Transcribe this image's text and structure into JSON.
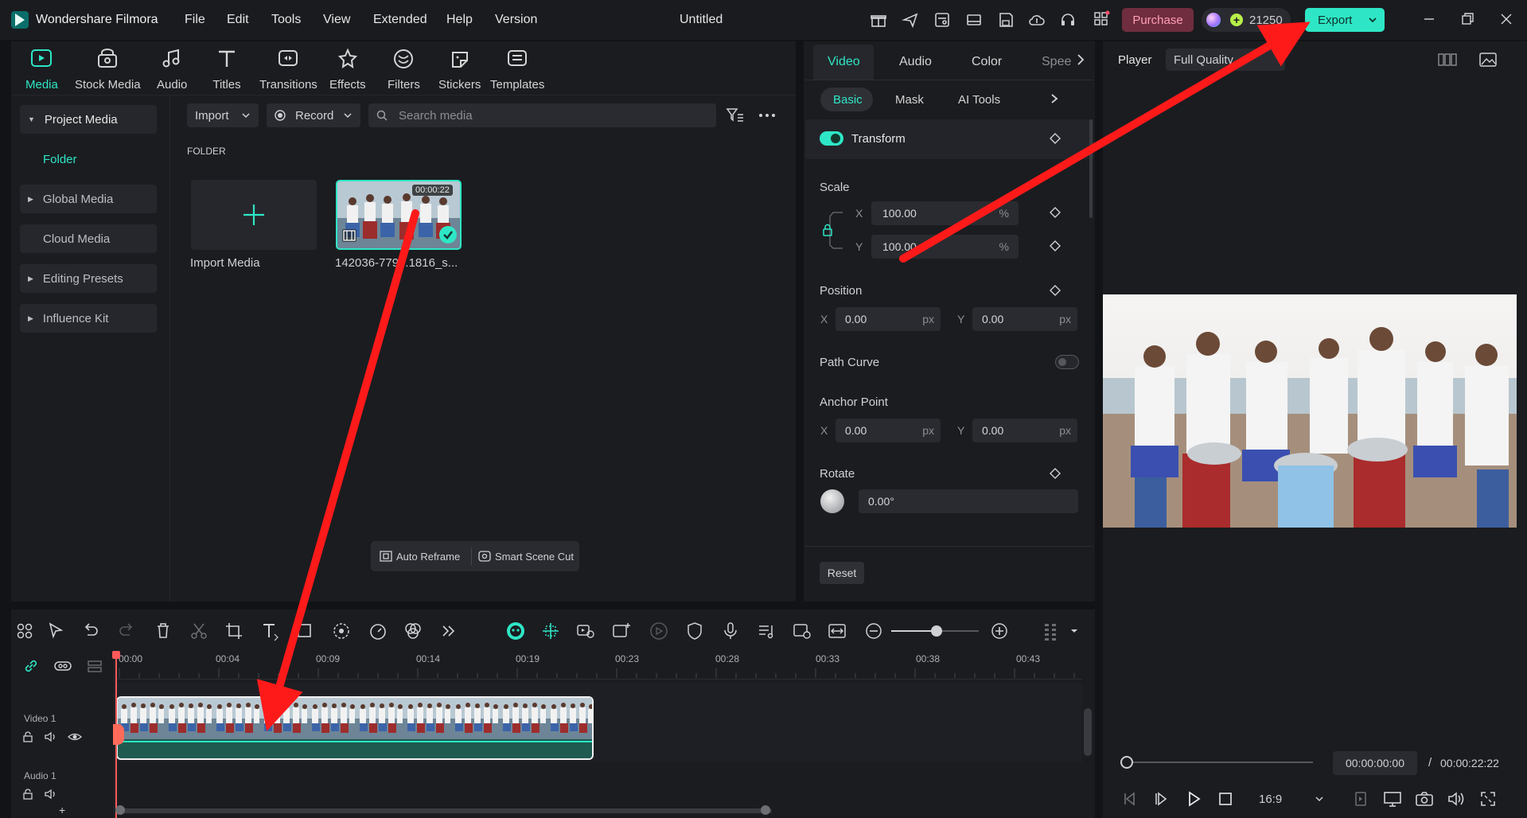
{
  "app": {
    "name": "Wondershare Filmora",
    "project_title": "Untitled",
    "menu": [
      "File",
      "Edit",
      "Tools",
      "View",
      "Extended",
      "Help",
      "Version"
    ],
    "purchase_label": "Purchase",
    "credits": "21250",
    "export_label": "Export"
  },
  "media_tabs": [
    "Media",
    "Stock Media",
    "Audio",
    "Titles",
    "Transitions",
    "Effects",
    "Filters",
    "Stickers",
    "Templates"
  ],
  "sidebar": {
    "project_media": "Project Media",
    "folder": "Folder",
    "items": [
      "Global Media",
      "Cloud Media",
      "Editing Presets",
      "Influence Kit"
    ]
  },
  "media_toolbar": {
    "import_label": "Import",
    "record_label": "Record",
    "search_placeholder": "Search media"
  },
  "library": {
    "section_label": "FOLDER",
    "import_tile_label": "Import Media",
    "clip": {
      "duration": "00:00:22",
      "name": "142036-779...1816_s..."
    }
  },
  "library_actions": {
    "auto_reframe": "Auto Reframe",
    "smart_scene_cut": "Smart Scene Cut"
  },
  "properties": {
    "tabs": [
      "Video",
      "Audio",
      "Color",
      "Spee"
    ],
    "subtabs": [
      "Basic",
      "Mask",
      "AI Tools"
    ],
    "transform_label": "Transform",
    "transform_enabled": true,
    "scale_label": "Scale",
    "scale_x": "100.00",
    "scale_y": "100.00",
    "percent": "%",
    "position_label": "Position",
    "position_x": "0.00",
    "position_y": "0.00",
    "px": "px",
    "path_curve_label": "Path Curve",
    "anchor_label": "Anchor Point",
    "anchor_x": "0.00",
    "anchor_y": "0.00",
    "rotate_label": "Rotate",
    "rotate_value": "0.00°",
    "reset_label": "Reset",
    "x": "X",
    "y": "Y"
  },
  "player": {
    "label": "Player",
    "quality": "Full Quality",
    "current_time": "00:00:00:00",
    "separator": "/",
    "total_time": "00:00:22:22",
    "aspect": "16:9"
  },
  "timeline": {
    "ruler": [
      "00:00",
      "00:04",
      "00:09",
      "00:14",
      "00:19",
      "00:23",
      "00:28",
      "00:33",
      "00:38",
      "00:43"
    ],
    "video_track": "Video 1",
    "audio_track": "Audio 1"
  },
  "colors": {
    "accent": "#2ee6c5",
    "export_bg": "#2ee6c5",
    "purchase_bg": "#6f2d3f",
    "arrow": "#ff1a1a",
    "playhead": "#ff5a5a"
  }
}
